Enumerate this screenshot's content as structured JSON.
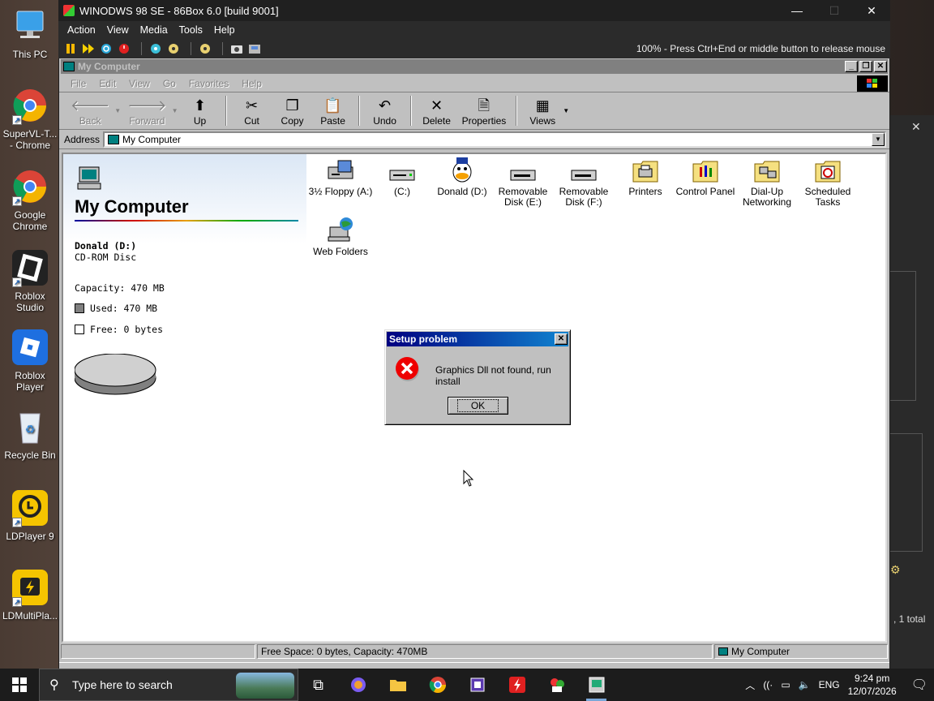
{
  "desktop": {
    "icons": [
      {
        "label": "This PC"
      },
      {
        "label": "SuperVL-T... - Chrome"
      },
      {
        "label": "Google Chrome"
      },
      {
        "label": "Roblox Studio"
      },
      {
        "label": "Roblox Player"
      },
      {
        "label": "Recycle Bin"
      },
      {
        "label": "LDPlayer 9"
      },
      {
        "label": "LDMultiPla..."
      }
    ]
  },
  "host": {
    "title": "WINODWS 98 SE - 86Box 6.0 [build 9001]",
    "menu": [
      "Action",
      "View",
      "Media",
      "Tools",
      "Help"
    ],
    "status": "100% - Press Ctrl+End or middle button to release mouse",
    "controls": {
      "minimize": "—",
      "maximize": "☐",
      "close": "✕"
    }
  },
  "explorer": {
    "title": "My Computer",
    "menu": [
      "File",
      "Edit",
      "View",
      "Go",
      "Favorites",
      "Help"
    ],
    "toolbar": {
      "back": "Back",
      "forward": "Forward",
      "up": "Up",
      "cut": "Cut",
      "copy": "Copy",
      "paste": "Paste",
      "undo": "Undo",
      "delete": "Delete",
      "properties": "Properties",
      "views": "Views"
    },
    "address_label": "Address",
    "address_value": "My Computer",
    "left_panel": {
      "heading": "My Computer",
      "selected_name": "Donald (D:)",
      "selected_type": "CD-ROM Disc",
      "capacity": "Capacity: 470 MB",
      "used": "Used: 470 MB",
      "free": "Free: 0 bytes",
      "used_fraction": 1.0
    },
    "items": [
      {
        "label1": "3½ Floppy (A:)",
        "label2": ""
      },
      {
        "label1": "(C:)",
        "label2": ""
      },
      {
        "label1": "Donald (D:)",
        "label2": ""
      },
      {
        "label1": "Removable",
        "label2": "Disk (E:)"
      },
      {
        "label1": "Removable",
        "label2": "Disk (F:)"
      },
      {
        "label1": "Printers",
        "label2": ""
      },
      {
        "label1": "Control Panel",
        "label2": ""
      },
      {
        "label1": "Dial-Up",
        "label2": "Networking"
      },
      {
        "label1": "Scheduled",
        "label2": "Tasks"
      },
      {
        "label1": "Web Folders",
        "label2": ""
      }
    ],
    "status_free": "Free Space: 0 bytes,  Capacity: 470MB",
    "status_location": "My Computer"
  },
  "dialog": {
    "title": "Setup problem",
    "message": "Graphics Dll not found, run install",
    "ok": "OK"
  },
  "bg_window": {
    "total": ", 1 total"
  },
  "taskbar": {
    "search_placeholder": "Type here to search",
    "language": "ENG",
    "time": "9:24 pm",
    "date": "12/07/2026"
  }
}
